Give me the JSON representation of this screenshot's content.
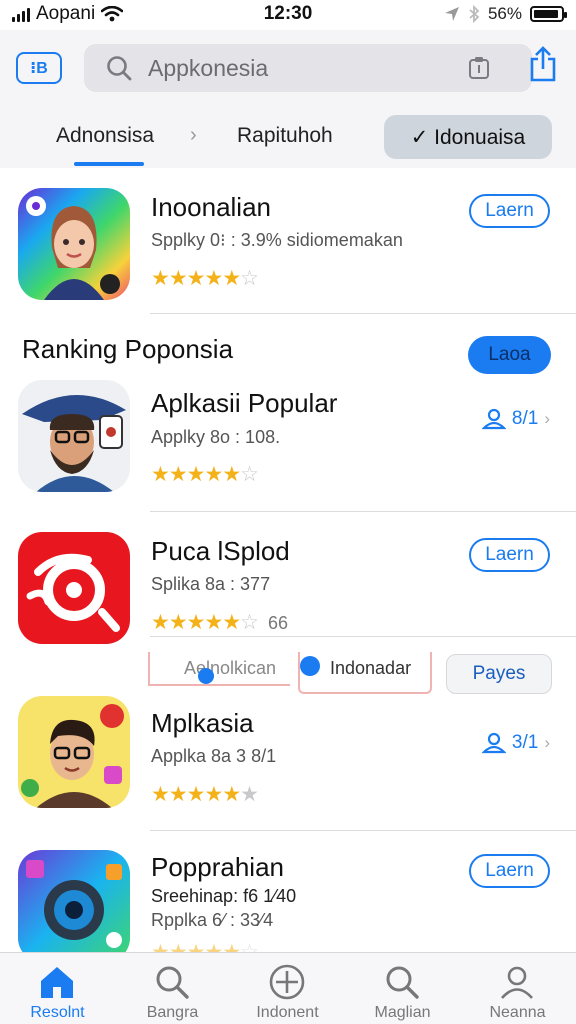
{
  "status_bar": {
    "carrier": "Aopani",
    "time": "12:30",
    "battery": "56%"
  },
  "header": {
    "back_label": "⁝B",
    "search": {
      "value": "Appkonesia",
      "placeholder": "Appkonesia"
    }
  },
  "filters": {
    "tab_a": "Adnonsisa",
    "tab_b": "Rapituhoh",
    "chip": "✓ Idonuaisa"
  },
  "apps": [
    {
      "name": "Inoonalian",
      "subtitle": "Spplky  0⁝ : 3.9% sidiomemakan",
      "rating": 4.5,
      "action": "Laern"
    },
    {
      "name": "Aplkasii Popular",
      "subtitle": "Applky 8o : 108.",
      "rating": 4.5,
      "rank": "8/1"
    },
    {
      "name": "Puca lSplod",
      "subtitle": "Splika 8a : 377",
      "rating": 4.5,
      "rating_extra": "66",
      "action": "Laern"
    },
    {
      "name": "Mplkasia",
      "subtitle": "Applka 8a 3 8/1",
      "rating": 4.5,
      "rank": "3/1"
    },
    {
      "name": "Popprahian",
      "subtitle": "Sreehinap: f6 1⁄40",
      "subtitle2": "Rpplka 6⁄ : 33⁄4",
      "rating": 4.5,
      "action": "Laern"
    }
  ],
  "section": {
    "title": "Ranking Poponsia",
    "button": "Laoa"
  },
  "subfilters": {
    "a": "Aelnolkican",
    "b": "Indonadar",
    "c": "Payes"
  },
  "tabbar": {
    "items": [
      {
        "label": "Resolnt",
        "icon": "home-icon"
      },
      {
        "label": "Bangra",
        "icon": "search-icon"
      },
      {
        "label": "Indonent",
        "icon": "plus-circle-icon"
      },
      {
        "label": "Maglian",
        "icon": "search-icon"
      },
      {
        "label": "Neanna",
        "icon": "person-icon"
      }
    ]
  },
  "colors": {
    "accent": "#1a7cf0",
    "star": "#f3b21a",
    "background": "#f5f5f7"
  }
}
